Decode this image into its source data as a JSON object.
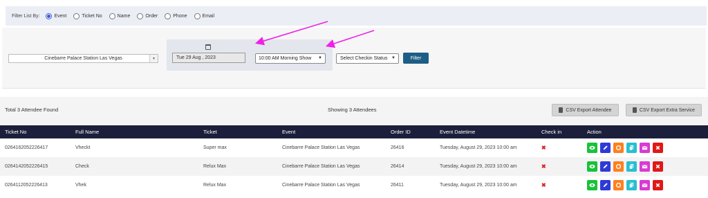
{
  "filter": {
    "label": "Filter List By:",
    "options": [
      {
        "label": "Event",
        "selected": true
      },
      {
        "label": "Ticket No",
        "selected": false
      },
      {
        "label": "Name",
        "selected": false
      },
      {
        "label": "Order",
        "selected": false
      },
      {
        "label": "Phone",
        "selected": false
      },
      {
        "label": "Email",
        "selected": false
      }
    ]
  },
  "controls": {
    "venue": "Cinebarre Palace Station Las Vegas",
    "date": "Tue 29 Aug , 2023",
    "show": "10:00 AM Morning Show",
    "checkin_status": "Select Checkin Status",
    "filter_button": "Filter"
  },
  "results": {
    "total": "Total 3 Attendee Found",
    "showing": "Showing 3 Attendees",
    "export_attendee": "CSV Export Attendee",
    "export_extra": "CSV Export Extra Service"
  },
  "table": {
    "headers": [
      "Ticket No",
      "Full Name",
      "Ticket",
      "Event",
      "Order ID",
      "Event Datetime",
      "Check in",
      "Action"
    ],
    "rows": [
      {
        "ticket_no": "0264162052226417",
        "name": "Vheckt",
        "ticket": "Super max",
        "event": "Cinebarre Palace Station Las Vegas",
        "order": "26416",
        "datetime": "Tuesday, August 29, 2023 10:00 am",
        "checkin": "✖"
      },
      {
        "ticket_no": "0264142052226415",
        "name": "Check",
        "ticket": "Relux Max",
        "event": "Cinebarre Palace Station Las Vegas",
        "order": "26414",
        "datetime": "Tuesday, August 29, 2023 10:00 am",
        "checkin": "✖"
      },
      {
        "ticket_no": "0264112052226413",
        "name": "Vhek",
        "ticket": "Relux Max",
        "event": "Cinebarre Palace Station Las Vegas",
        "order": "26411",
        "datetime": "Tuesday, August 29, 2023 10:00 am",
        "checkin": "✖"
      }
    ]
  },
  "colors": {
    "header_bg": "#1b1f3b",
    "filter_button": "#1d5e86",
    "annotation_arrow": "#f020e8",
    "view": "#19c23a",
    "edit": "#2e3ad6",
    "sync": "#ff7f1e",
    "copy": "#27c0cf",
    "mail": "#d83ad2",
    "delete": "#e01818"
  }
}
